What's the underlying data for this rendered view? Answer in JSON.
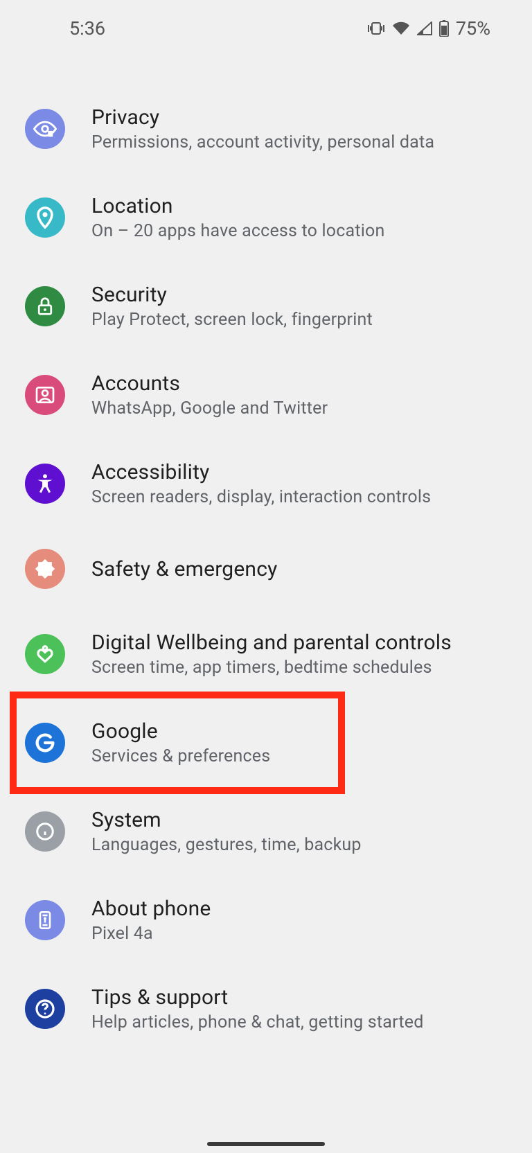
{
  "statusbar": {
    "time": "5:36",
    "battery_percent": "75%"
  },
  "settings": [
    {
      "key": "privacy",
      "title": "Privacy",
      "subtitle": "Permissions, account activity, personal data",
      "icon": "eye",
      "color": "#7a8ae5"
    },
    {
      "key": "location",
      "title": "Location",
      "subtitle": "On – 20 apps have access to location",
      "icon": "pin",
      "color": "#38b9c7"
    },
    {
      "key": "security",
      "title": "Security",
      "subtitle": "Play Protect, screen lock, fingerprint",
      "icon": "lock",
      "color": "#2f8b41"
    },
    {
      "key": "accounts",
      "title": "Accounts",
      "subtitle": "WhatsApp, Google and Twitter",
      "icon": "account",
      "color": "#d84b7a"
    },
    {
      "key": "accessibility",
      "title": "Accessibility",
      "subtitle": "Screen readers, display, interaction controls",
      "icon": "accessibility",
      "color": "#5e0fd0"
    },
    {
      "key": "safety",
      "title": "Safety & emergency",
      "subtitle": "",
      "icon": "medical",
      "color": "#e58c7c"
    },
    {
      "key": "wellbeing",
      "title": "Digital Wellbeing and parental controls",
      "subtitle": "Screen time, app timers, bedtime schedules",
      "icon": "wellbeing",
      "color": "#4cc159"
    },
    {
      "key": "google",
      "title": "Google",
      "subtitle": "Services & preferences",
      "icon": "google",
      "color": "#1e73d8",
      "highlighted": true
    },
    {
      "key": "system",
      "title": "System",
      "subtitle": "Languages, gestures, time, backup",
      "icon": "info",
      "color": "#9aa0a6"
    },
    {
      "key": "about",
      "title": "About phone",
      "subtitle": "Pixel 4a",
      "icon": "phone",
      "color": "#7a8ae5"
    },
    {
      "key": "tips",
      "title": "Tips & support",
      "subtitle": "Help articles, phone & chat, getting started",
      "icon": "help",
      "color": "#1d3fa0"
    }
  ]
}
